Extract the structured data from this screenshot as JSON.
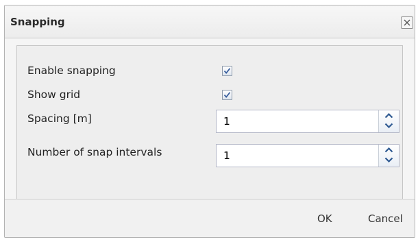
{
  "dialog": {
    "title": "Snapping",
    "close_icon": "close-icon"
  },
  "form": {
    "enable_snapping": {
      "label": "Enable snapping",
      "checked": true
    },
    "show_grid": {
      "label": "Show grid",
      "checked": true
    },
    "spacing": {
      "label": "Spacing [m]",
      "value": "1"
    },
    "snap_intervals": {
      "label": "Number of snap intervals",
      "value": "1"
    }
  },
  "footer": {
    "ok_label": "OK",
    "cancel_label": "Cancel"
  },
  "colors": {
    "checkmark": "#3a5f9e",
    "spinner_arrow": "#2f5a92"
  }
}
